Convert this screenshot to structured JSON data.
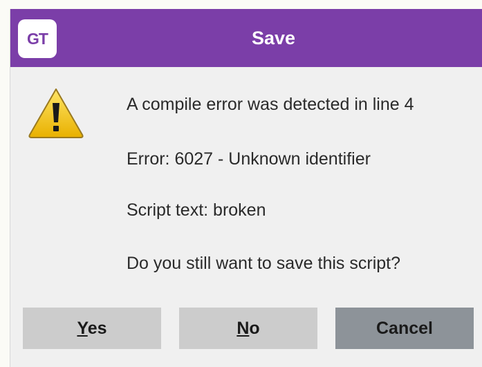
{
  "dialog": {
    "title": "Save",
    "app_logo_text": "GT",
    "icon": "warning-icon"
  },
  "messages": {
    "line1": "A compile error was detected in line 4",
    "line2": "Error:  6027 - Unknown identifier",
    "line3": "Script text:  broken",
    "line4": "Do you still want to save this script?"
  },
  "buttons": {
    "yes_accel": "Y",
    "yes_rest": "es",
    "no_accel": "N",
    "no_rest": "o",
    "cancel": "Cancel"
  },
  "colors": {
    "titlebar": "#7b3ea8",
    "dialog_bg": "#f0f0f0",
    "button_bg": "#cccccc",
    "cancel_bg": "#8d9399",
    "warning_fill": "#f2c200"
  }
}
